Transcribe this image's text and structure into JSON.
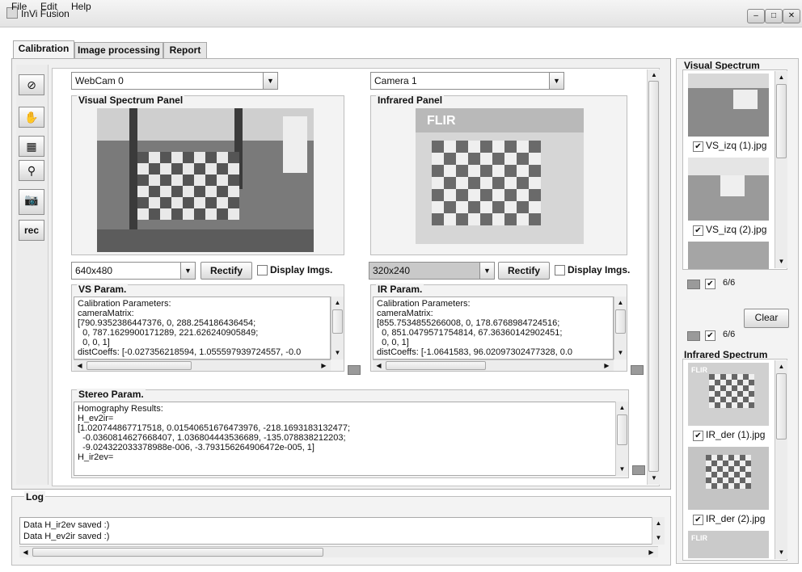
{
  "window": {
    "title": "InVi Fusion",
    "controls": {
      "minimize": "–",
      "maximize": "□",
      "close": "✕"
    }
  },
  "menu": {
    "file": "File",
    "edit": "Edit",
    "help": "Help"
  },
  "tabs": {
    "calibration": "Calibration",
    "image_processing": "Image processing",
    "report": "Report"
  },
  "toolbar": {
    "rec": "rec"
  },
  "vs": {
    "source": "WebCam 0",
    "panel_title": "Visual Spectrum Panel",
    "resolution": "640x480",
    "rectify": "Rectify",
    "display_imgs": "Display Imgs.",
    "param_title": "VS Param.",
    "param_text": "Calibration Parameters:\ncameraMatrix:\n[790.9352386447376, 0, 288.254186436454;\n  0, 787.1629900171289, 221.626240905849;\n  0, 0, 1]\ndistCoeffs: [-0.027356218594, 1.055597939724557, -0.0"
  },
  "ir": {
    "source": "Camera 1",
    "panel_title": "Infrared Panel",
    "brand": "FLIR",
    "resolution": "320x240",
    "rectify": "Rectify",
    "display_imgs": "Display Imgs.",
    "param_title": "IR Param.",
    "param_text": "Calibration Parameters:\ncameraMatrix:\n[855.7534855266008, 0, 178.6768984724516;\n  0, 851.0479571754814, 67.36360142902451;\n  0, 0, 1]\ndistCoeffs: [-1.0641583, 96.02097302477328, 0.0"
  },
  "stereo": {
    "title": "Stereo Param.",
    "text": "Homography Results:\nH_ev2ir=\n[1.020744867717518, 0.01540651676473976, -218.1693183132477;\n  -0.0360814627668407, 1.036804443536689, -135.078838212203;\n  -9.024322033378988e-006, -3.793156264906472e-005, 1]\nH_ir2ev="
  },
  "log": {
    "title": "Log",
    "lines": [
      "Data H_ir2ev saved :)",
      "Data H_ev2ir saved :)"
    ]
  },
  "right": {
    "vs_title": "Visual Spectrum",
    "vs_items": [
      "VS_izq (1).jpg",
      "VS_izq (2).jpg"
    ],
    "vs_count": "6/6",
    "clear": "Clear",
    "ir_count": "6/6",
    "ir_title": "Infrared Spectrum",
    "ir_items": [
      "IR_der (1).jpg",
      "IR_der (2).jpg"
    ],
    "ir_brand": "FLIR"
  },
  "icons": {
    "check": "✔",
    "dropdown": "▼",
    "up": "▲",
    "down": "▼",
    "left": "◀",
    "right": "▶"
  }
}
